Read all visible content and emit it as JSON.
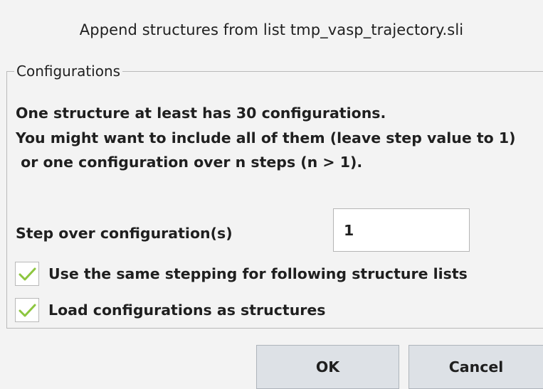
{
  "dialog": {
    "title": "Append structures from list tmp_vasp_trajectory.sli"
  },
  "configurations": {
    "legend": "Configurations",
    "message_line1": "One structure at least has 30 configurations.",
    "message_line2": "You might want to include all of them (leave step value to 1)",
    "message_line3": " or one configuration over n steps (n > 1).",
    "step_label": "Step over configuration(s)",
    "step_value": "1",
    "checkbox_same_stepping": {
      "label": "Use the same stepping for following structure lists",
      "checked": true
    },
    "checkbox_load_as_structures": {
      "label": "Load configurations as structures",
      "checked": true
    }
  },
  "buttons": {
    "ok_label": "OK",
    "cancel_label": "Cancel"
  },
  "colors": {
    "checkmark": "#8dc63f",
    "button_bg": "#dde1e6",
    "background": "#f3f3f3"
  },
  "icons": {
    "checkbox_mark": "checkmark-icon"
  }
}
